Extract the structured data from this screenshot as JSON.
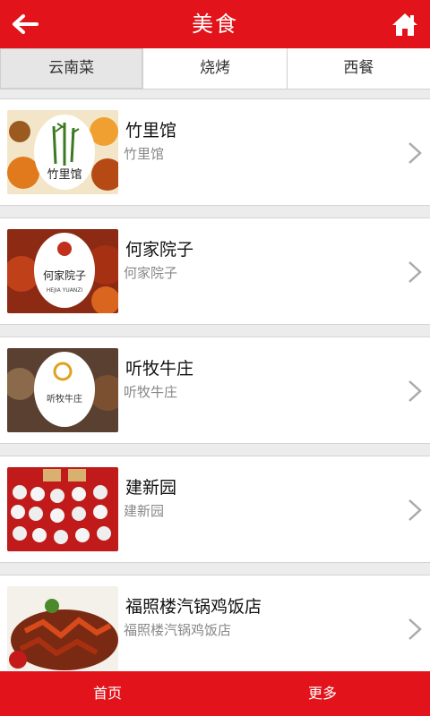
{
  "header": {
    "title": "美食",
    "back_icon": "arrow-left-icon",
    "home_icon": "home-icon"
  },
  "tabs": [
    {
      "label": "云南菜",
      "active": true
    },
    {
      "label": "烧烤",
      "active": false
    },
    {
      "label": "西餐",
      "active": false
    }
  ],
  "restaurants": [
    {
      "name": "竹里馆",
      "subtitle": "竹里馆"
    },
    {
      "name": "何家院子",
      "subtitle": "何家院子"
    },
    {
      "name": "听牧牛庄",
      "subtitle": "听牧牛庄"
    },
    {
      "name": "建新园",
      "subtitle": "建新园"
    },
    {
      "name": "福照楼汽锅鸡饭店",
      "subtitle": "福照楼汽锅鸡饭店"
    }
  ],
  "footer": {
    "home_label": "首页",
    "more_label": "更多"
  },
  "colors": {
    "brand_red": "#e2131b",
    "background": "#ececec"
  }
}
